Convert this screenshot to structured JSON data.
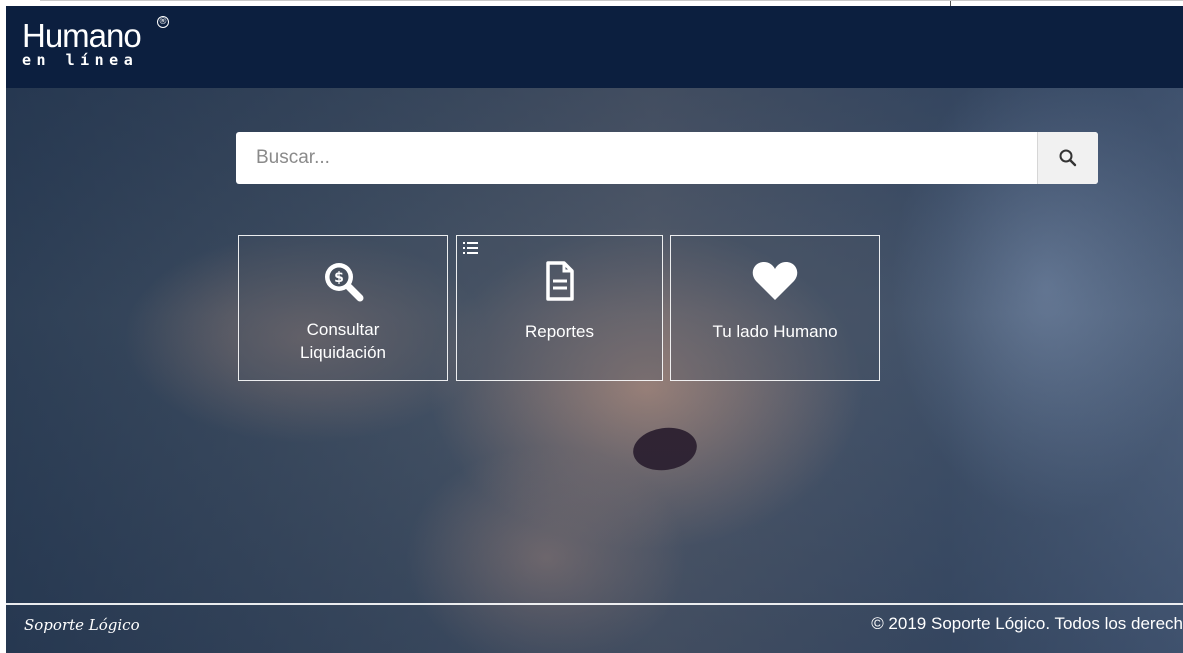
{
  "header": {
    "logo_main": "Humano",
    "logo_reg": "®",
    "logo_sub": "en línea"
  },
  "search": {
    "placeholder": "Buscar...",
    "value": ""
  },
  "tiles": [
    {
      "label": "Consultar\nLiquidación",
      "icon": "search-dollar-icon"
    },
    {
      "label": "Reportes",
      "icon": "document-icon"
    },
    {
      "label": "Tu lado Humano",
      "icon": "heart-icon"
    }
  ],
  "footer": {
    "brand": "Soporte Lógico",
    "copyright": "© 2019 Soporte Lógico. Todos los derech"
  },
  "colors": {
    "header_bg": "#0c1f3f",
    "tile_border": "#ffffff"
  }
}
